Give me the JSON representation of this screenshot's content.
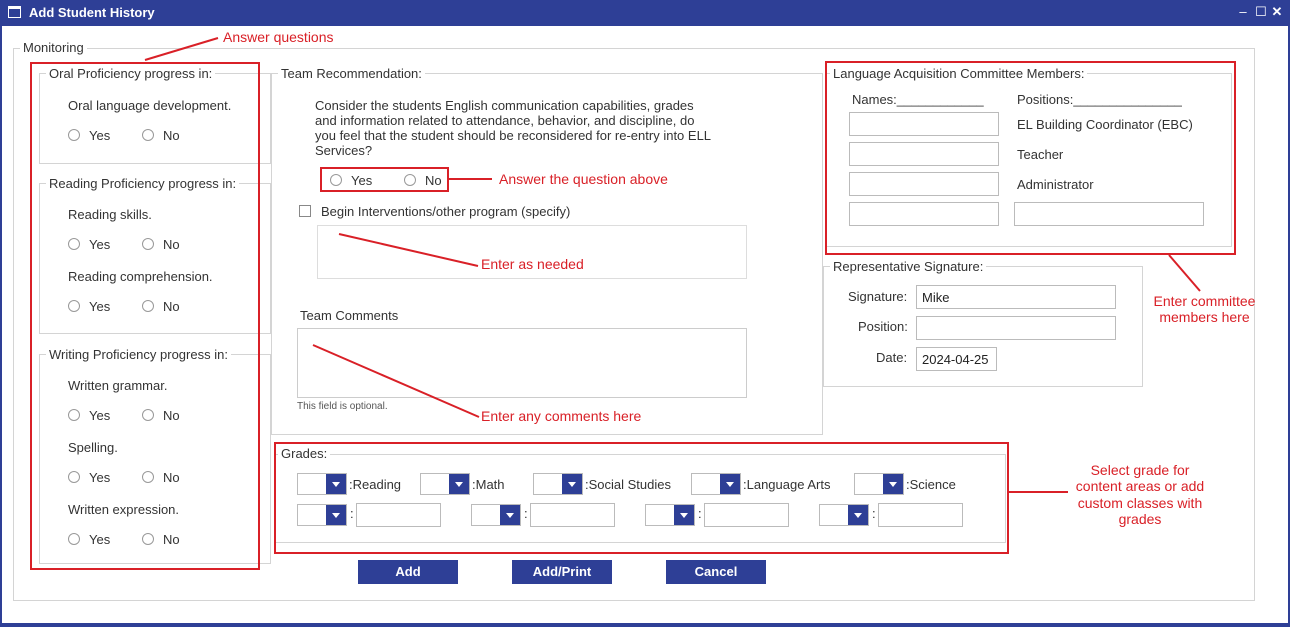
{
  "window": {
    "title": "Add Student History"
  },
  "monitoring": {
    "legend": "Monitoring",
    "oral": {
      "legend": "Oral Proficiency progress in:",
      "q1": "Oral language development."
    },
    "reading": {
      "legend": "Reading Proficiency progress in:",
      "q1": "Reading skills.",
      "q2": "Reading comprehension."
    },
    "writing": {
      "legend": "Writing Proficiency progress in:",
      "q1": "Written grammar.",
      "q2": "Spelling.",
      "q3": "Written expression."
    },
    "yes": "Yes",
    "no": "No"
  },
  "team": {
    "legend": "Team Recommendation:",
    "question_l1": "Consider the students English communication capabilities, grades",
    "question_l2": "and information related to attendance, behavior, and discipline, do",
    "question_l3": "you feel that the student should be reconsidered for re-entry into ELL",
    "question_l4": "Services?",
    "yes": "Yes",
    "no": "No",
    "interventions_label": "Begin Interventions/other program (specify)",
    "comments_label": "Team Comments",
    "optional_note": "This field is optional."
  },
  "committee": {
    "legend": "Language Acquisition Committee Members:",
    "names_header": "Names:____________",
    "positions_header": "Positions:_______________",
    "positions": [
      "EL Building Coordinator (EBC)",
      "Teacher",
      "Administrator"
    ]
  },
  "signature": {
    "legend": "Representative Signature:",
    "signature_label": "Signature:",
    "signature_value": "Mike",
    "position_label": "Position:",
    "position_value": "",
    "date_label": "Date:",
    "date_value": "2024-04-25"
  },
  "grades": {
    "legend": "Grades:",
    "subjects": [
      ":Reading",
      ":Math",
      ":Social Studies",
      ":Language Arts",
      ":Science"
    ],
    "custom_sep": ":"
  },
  "buttons": {
    "add": "Add",
    "add_print": "Add/Print",
    "cancel": "Cancel"
  },
  "annotations": {
    "answer_questions": "Answer questions",
    "answer_above": "Answer the question above",
    "enter_needed": "Enter as needed",
    "enter_comments": "Enter any comments here",
    "committee_l1": "Enter committee",
    "committee_l2": "members here",
    "grades_l1": "Select grade for",
    "grades_l2": "content areas or add",
    "grades_l3": "custom classes with",
    "grades_l4": "grades",
    "color": "#d92027"
  },
  "theme": {
    "primary": "#2e3f96"
  }
}
